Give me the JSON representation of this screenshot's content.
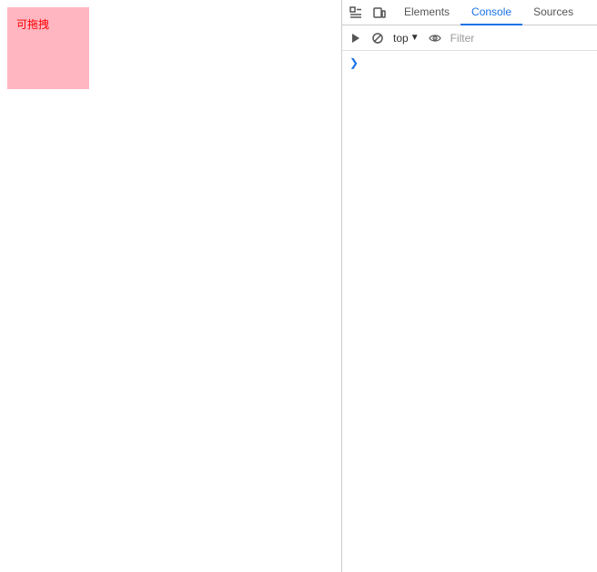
{
  "page": {
    "box_label": "可拖拽"
  },
  "devtools": {
    "tabs": [
      {
        "id": "elements",
        "label": "Elements",
        "active": false
      },
      {
        "id": "console",
        "label": "Console",
        "active": true
      },
      {
        "id": "sources",
        "label": "Sources",
        "active": false
      }
    ],
    "toolbar": {
      "top_label": "top",
      "filter_placeholder": "Filter"
    }
  }
}
